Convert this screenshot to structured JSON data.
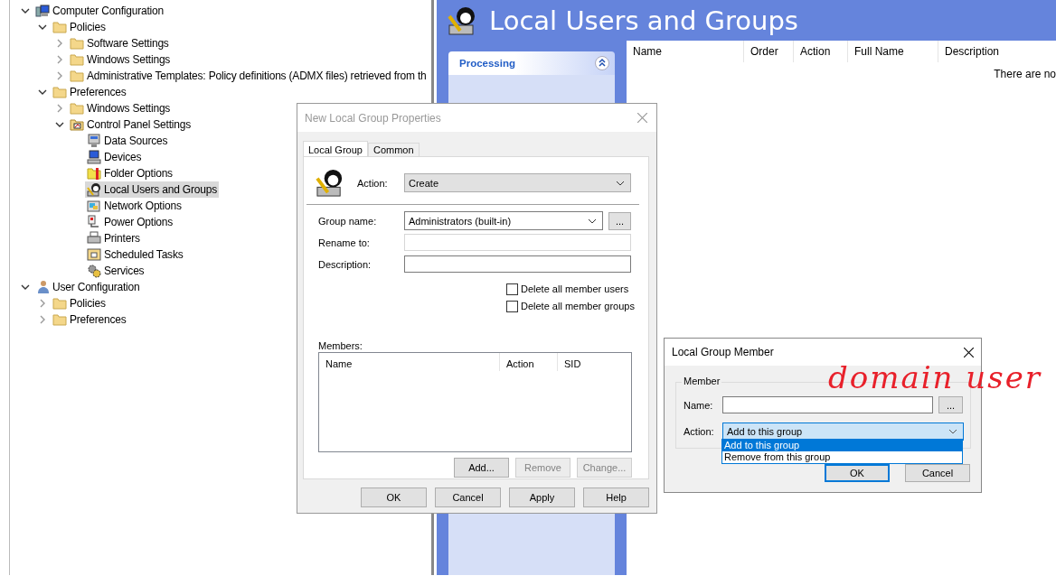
{
  "tree": [
    {
      "label": "Computer Configuration",
      "kind": "computer",
      "expanded": true,
      "selected": false,
      "children": [
        {
          "label": "Policies",
          "kind": "folder",
          "expanded": true,
          "selected": false,
          "children": [
            {
              "label": "Software Settings",
              "kind": "folder",
              "expanded": false,
              "selected": false
            },
            {
              "label": "Windows Settings",
              "kind": "folder",
              "expanded": false,
              "selected": false
            },
            {
              "label": "Administrative Templates: Policy definitions (ADMX files) retrieved from th",
              "kind": "folder",
              "expanded": false,
              "selected": false
            }
          ]
        },
        {
          "label": "Preferences",
          "kind": "folder",
          "expanded": true,
          "selected": false,
          "children": [
            {
              "label": "Windows Settings",
              "kind": "folder",
              "expanded": false,
              "selected": false
            },
            {
              "label": "Control Panel Settings",
              "kind": "control-panel",
              "expanded": true,
              "selected": false,
              "children": [
                {
                  "label": "Data Sources",
                  "kind": "data-sources",
                  "selected": false
                },
                {
                  "label": "Devices",
                  "kind": "devices",
                  "selected": false
                },
                {
                  "label": "Folder Options",
                  "kind": "folder-options",
                  "selected": false
                },
                {
                  "label": "Local Users and Groups",
                  "kind": "users",
                  "selected": true
                },
                {
                  "label": "Network Options",
                  "kind": "network",
                  "selected": false
                },
                {
                  "label": "Power Options",
                  "kind": "power",
                  "selected": false
                },
                {
                  "label": "Printers",
                  "kind": "printer",
                  "selected": false
                },
                {
                  "label": "Scheduled Tasks",
                  "kind": "tasks",
                  "selected": false
                },
                {
                  "label": "Services",
                  "kind": "services",
                  "selected": false
                }
              ]
            }
          ]
        }
      ]
    },
    {
      "label": "User Configuration",
      "kind": "user",
      "expanded": true,
      "selected": false,
      "children": [
        {
          "label": "Policies",
          "kind": "folder",
          "expanded": false,
          "selected": false
        },
        {
          "label": "Preferences",
          "kind": "folder",
          "expanded": false,
          "selected": false
        }
      ]
    }
  ],
  "right_pane": {
    "title": "Local Users and Groups",
    "processing_panel": {
      "title": "Processing"
    },
    "table": {
      "columns": [
        "Name",
        "Order",
        "Action",
        "Full Name",
        "Description"
      ],
      "empty_message": "There are no"
    }
  },
  "properties_dialog": {
    "title": "New Local Group Properties",
    "tabs": [
      {
        "label": "Local Group",
        "selected": true
      },
      {
        "label": "Common",
        "selected": false
      }
    ],
    "action": {
      "label": "Action:",
      "value": "Create"
    },
    "group_name": {
      "label": "Group name:",
      "value": "Administrators (built-in)",
      "browse": "..."
    },
    "rename_to": {
      "label": "Rename to:"
    },
    "description": {
      "label": "Description:"
    },
    "checkboxes": [
      {
        "label": "Delete all member users",
        "checked": false
      },
      {
        "label": "Delete all member groups",
        "checked": false
      }
    ],
    "members": {
      "label": "Members:",
      "columns": [
        "Name",
        "Action",
        "SID"
      ]
    },
    "member_buttons": [
      {
        "label": "Add...",
        "disabled": false
      },
      {
        "label": "Remove",
        "disabled": true
      },
      {
        "label": "Change...",
        "disabled": true
      }
    ],
    "buttons": [
      "OK",
      "Cancel",
      "Apply",
      "Help"
    ]
  },
  "member_dialog": {
    "title": "Local Group Member",
    "group_label": "Member",
    "name": {
      "label": "Name:",
      "browse": "..."
    },
    "action": {
      "label": "Action:",
      "value": "Add to this group",
      "options": [
        {
          "label": "Add to this group",
          "selected": true
        },
        {
          "label": "Remove from this group",
          "selected": false
        }
      ]
    },
    "buttons": [
      {
        "label": "OK",
        "default": true
      },
      {
        "label": "Cancel",
        "default": false
      }
    ]
  },
  "annotation": "domain user"
}
